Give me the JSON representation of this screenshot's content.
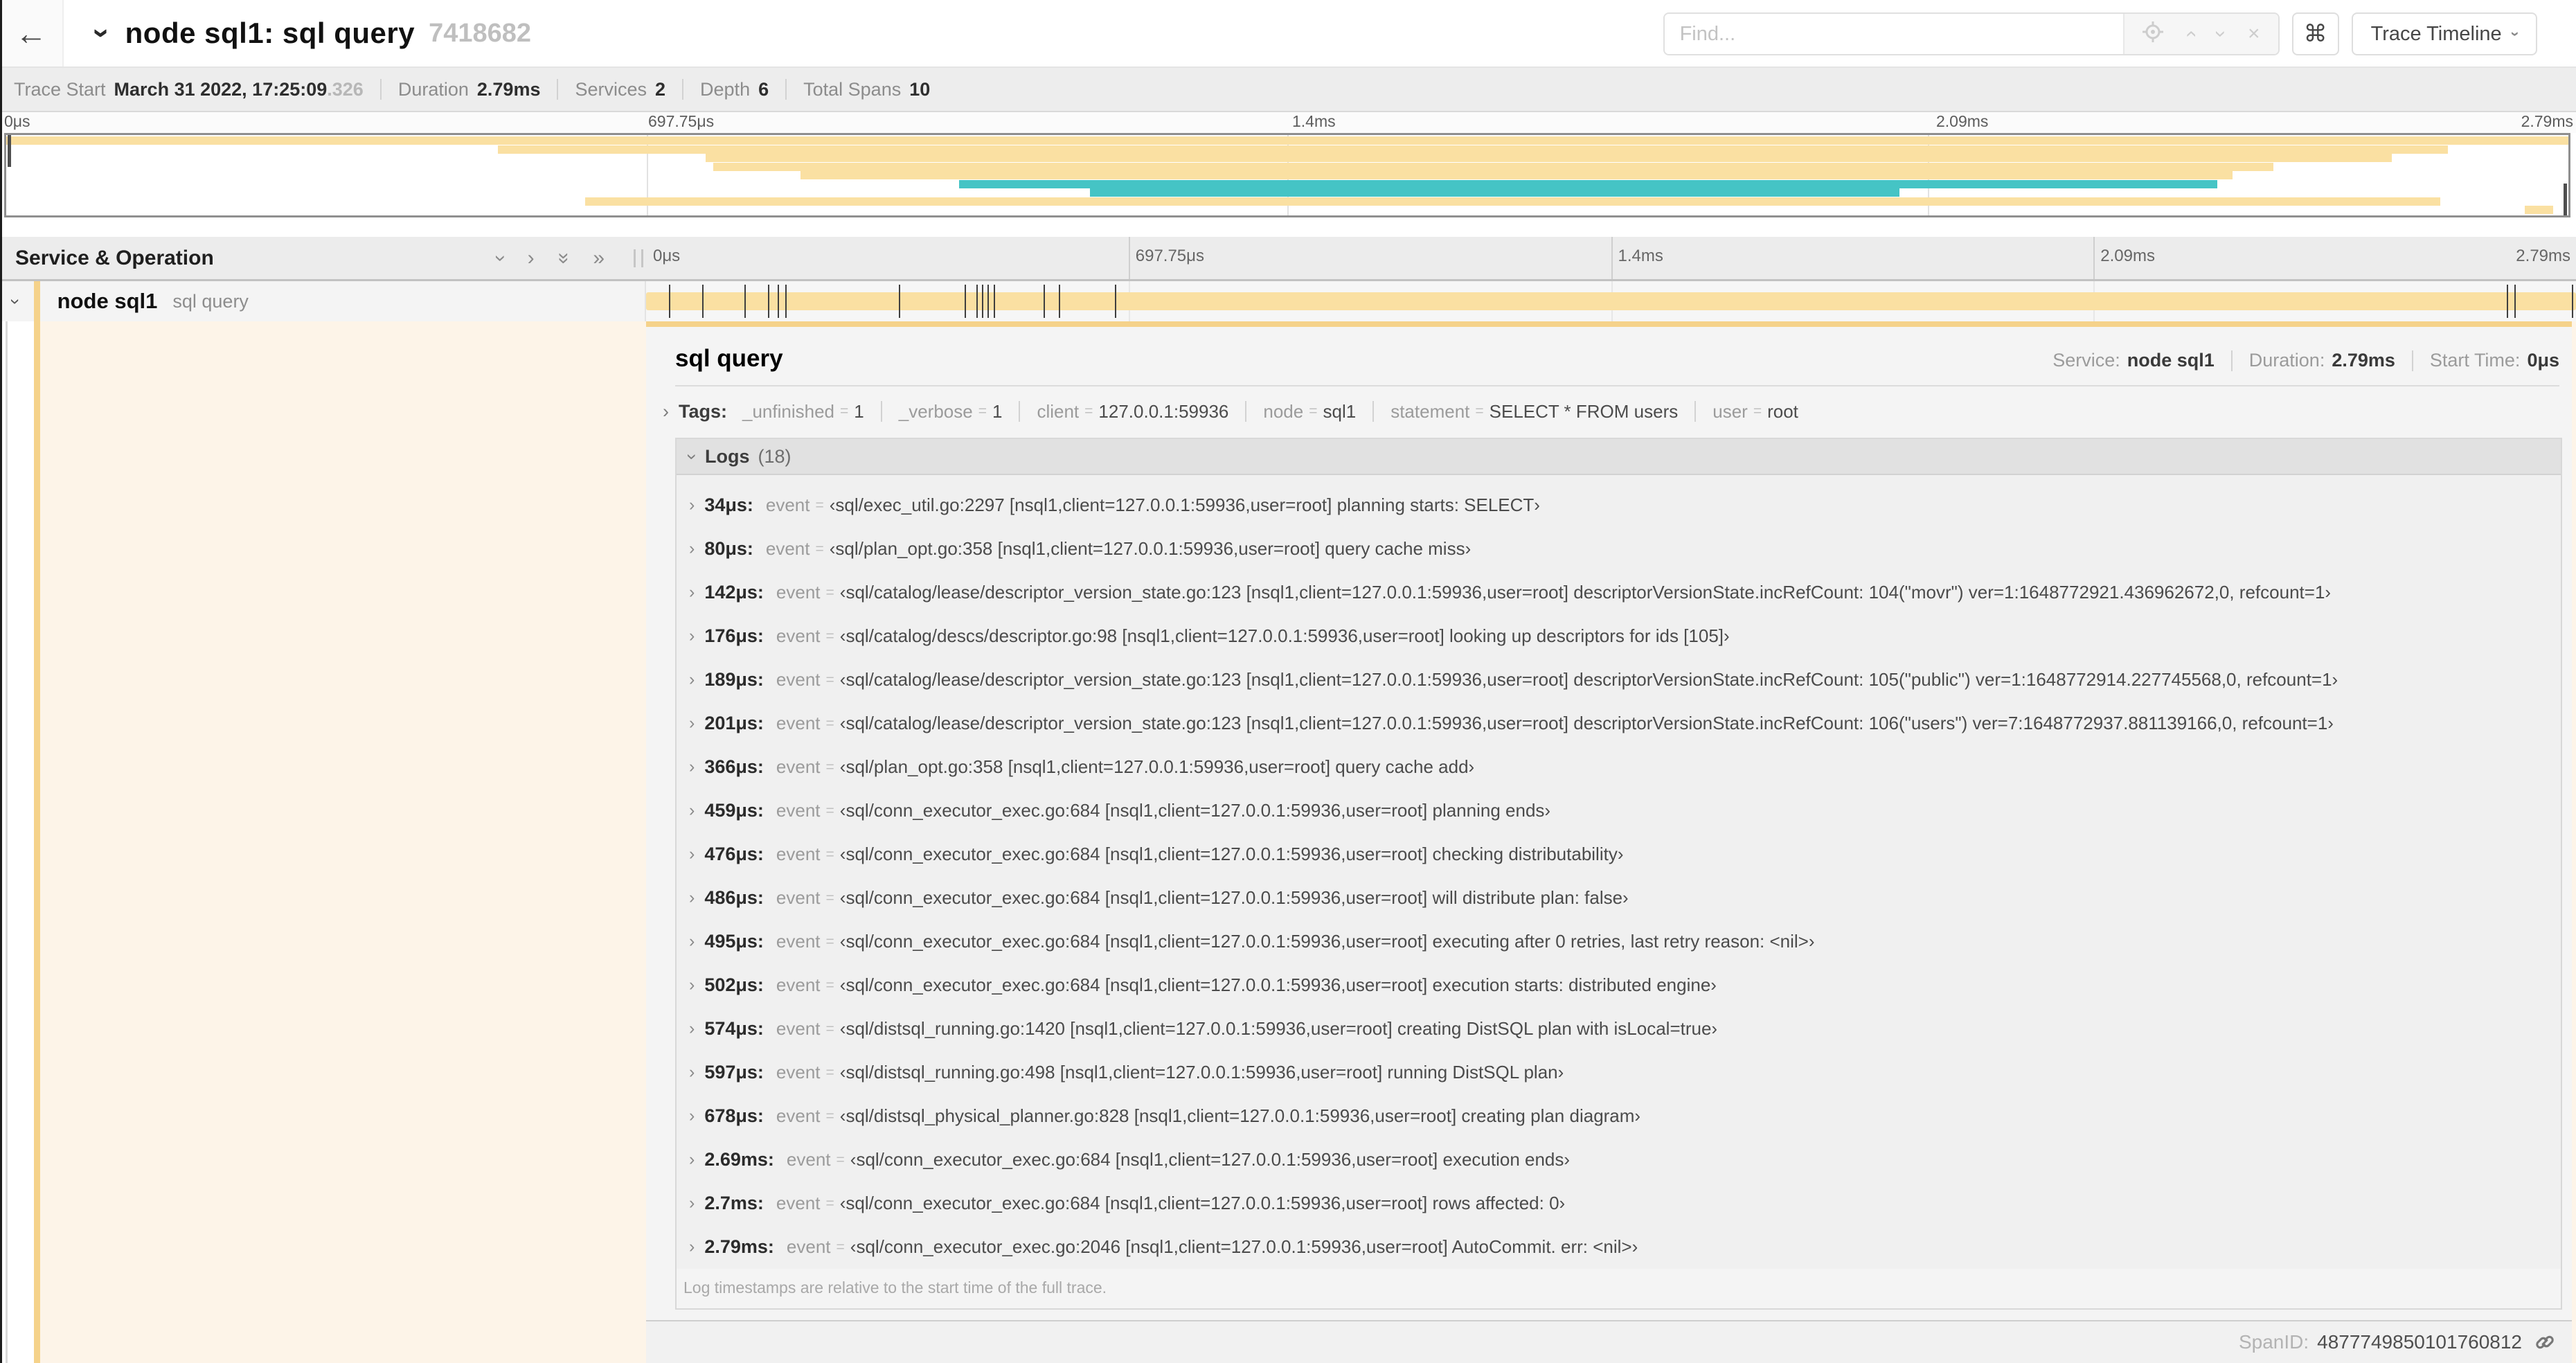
{
  "colors": {
    "orange": "#FAE0A2",
    "orange_accent": "#F5D28A",
    "teal": "#45C4C5",
    "cream": "#FDF4E8"
  },
  "header": {
    "title": "node sql1: sql query",
    "trace_id": "7418682",
    "find_placeholder": "Find...",
    "shortcut_key": "⌘",
    "view_label": "Trace Timeline"
  },
  "summary": {
    "items": [
      {
        "label": "Trace Start",
        "value": "March 31 2022, 17:25:09",
        "suffix": ".326"
      },
      {
        "label": "Duration",
        "value": "2.79ms"
      },
      {
        "label": "Services",
        "value": "2"
      },
      {
        "label": "Depth",
        "value": "6"
      },
      {
        "label": "Total Spans",
        "value": "10"
      }
    ]
  },
  "timeline": {
    "left_header": "Service & Operation",
    "ticks": [
      {
        "label": "0μs",
        "pct": 0
      },
      {
        "label": "697.75μs",
        "pct": 25
      },
      {
        "label": "1.4ms",
        "pct": 50
      },
      {
        "label": "2.09ms",
        "pct": 75
      },
      {
        "label": "2.79ms",
        "pct": 100
      }
    ],
    "grid_pcts": [
      25,
      50,
      75
    ],
    "row": {
      "service": "node sql1",
      "operation": "sql query",
      "bar_start_pct": 0,
      "bar_end_pct": 100,
      "tick_pcts": [
        1.2,
        2.9,
        5.1,
        6.3,
        6.8,
        7.2,
        13.1,
        16.5,
        17.1,
        17.4,
        17.7,
        18.0,
        20.6,
        21.4,
        24.3,
        96.4,
        96.8,
        99.8
      ]
    }
  },
  "minimap": {
    "spans": [
      {
        "color": "orange",
        "start_pct": 0,
        "end_pct": 100
      },
      {
        "color": "orange",
        "start_pct": 19.2,
        "end_pct": 95.3
      },
      {
        "color": "orange",
        "start_pct": 27.3,
        "end_pct": 93.1
      },
      {
        "color": "orange",
        "start_pct": 27.6,
        "end_pct": 88.5
      },
      {
        "color": "orange",
        "start_pct": 31.0,
        "end_pct": 86.9
      },
      {
        "color": "teal",
        "start_pct": 37.2,
        "end_pct": 86.3
      },
      {
        "color": "teal",
        "start_pct": 42.3,
        "end_pct": 73.9
      },
      {
        "color": "orange",
        "start_pct": 22.6,
        "end_pct": 95.0
      },
      {
        "color": "orange",
        "start_pct": 98.3,
        "end_pct": 99.4
      }
    ]
  },
  "detail": {
    "title": "sql query",
    "meta": [
      {
        "label": "Service:",
        "value": "node sql1"
      },
      {
        "label": "Duration:",
        "value": "2.79ms"
      },
      {
        "label": "Start Time:",
        "value": "0μs"
      }
    ],
    "tags_label": "Tags:",
    "tags": [
      {
        "key": "_unfinished",
        "value": "1"
      },
      {
        "key": "_verbose",
        "value": "1"
      },
      {
        "key": "client",
        "value": "127.0.0.1:59936"
      },
      {
        "key": "node",
        "value": "sql1"
      },
      {
        "key": "statement",
        "value": "SELECT * FROM users"
      },
      {
        "key": "user",
        "value": "root"
      }
    ],
    "logs_label": "Logs",
    "logs_count": "(18)",
    "logs": [
      {
        "time": "34μs:",
        "key": "event",
        "value": "‹sql/exec_util.go:2297 [nsql1,client=127.0.0.1:59936,user=root] planning starts: SELECT›"
      },
      {
        "time": "80μs:",
        "key": "event",
        "value": "‹sql/plan_opt.go:358 [nsql1,client=127.0.0.1:59936,user=root] query cache miss›"
      },
      {
        "time": "142μs:",
        "key": "event",
        "value": "‹sql/catalog/lease/descriptor_version_state.go:123 [nsql1,client=127.0.0.1:59936,user=root] descriptorVersionState.incRefCount: 104(\"movr\") ver=1:1648772921.436962672,0, refcount=1›"
      },
      {
        "time": "176μs:",
        "key": "event",
        "value": "‹sql/catalog/descs/descriptor.go:98 [nsql1,client=127.0.0.1:59936,user=root] looking up descriptors for ids [105]›"
      },
      {
        "time": "189μs:",
        "key": "event",
        "value": "‹sql/catalog/lease/descriptor_version_state.go:123 [nsql1,client=127.0.0.1:59936,user=root] descriptorVersionState.incRefCount: 105(\"public\") ver=1:1648772914.227745568,0, refcount=1›"
      },
      {
        "time": "201μs:",
        "key": "event",
        "value": "‹sql/catalog/lease/descriptor_version_state.go:123 [nsql1,client=127.0.0.1:59936,user=root] descriptorVersionState.incRefCount: 106(\"users\") ver=7:1648772937.881139166,0, refcount=1›"
      },
      {
        "time": "366μs:",
        "key": "event",
        "value": "‹sql/plan_opt.go:358 [nsql1,client=127.0.0.1:59936,user=root] query cache add›"
      },
      {
        "time": "459μs:",
        "key": "event",
        "value": "‹sql/conn_executor_exec.go:684 [nsql1,client=127.0.0.1:59936,user=root] planning ends›"
      },
      {
        "time": "476μs:",
        "key": "event",
        "value": "‹sql/conn_executor_exec.go:684 [nsql1,client=127.0.0.1:59936,user=root] checking distributability›"
      },
      {
        "time": "486μs:",
        "key": "event",
        "value": "‹sql/conn_executor_exec.go:684 [nsql1,client=127.0.0.1:59936,user=root] will distribute plan: false›"
      },
      {
        "time": "495μs:",
        "key": "event",
        "value": "‹sql/conn_executor_exec.go:684 [nsql1,client=127.0.0.1:59936,user=root] executing after 0 retries, last retry reason: <nil>›"
      },
      {
        "time": "502μs:",
        "key": "event",
        "value": "‹sql/conn_executor_exec.go:684 [nsql1,client=127.0.0.1:59936,user=root] execution starts: distributed engine›"
      },
      {
        "time": "574μs:",
        "key": "event",
        "value": "‹sql/distsql_running.go:1420 [nsql1,client=127.0.0.1:59936,user=root] creating DistSQL plan with isLocal=true›"
      },
      {
        "time": "597μs:",
        "key": "event",
        "value": "‹sql/distsql_running.go:498 [nsql1,client=127.0.0.1:59936,user=root] running DistSQL plan›"
      },
      {
        "time": "678μs:",
        "key": "event",
        "value": "‹sql/distsql_physical_planner.go:828 [nsql1,client=127.0.0.1:59936,user=root] creating plan diagram›"
      },
      {
        "time": "2.69ms:",
        "key": "event",
        "value": "‹sql/conn_executor_exec.go:684 [nsql1,client=127.0.0.1:59936,user=root] execution ends›"
      },
      {
        "time": "2.7ms:",
        "key": "event",
        "value": "‹sql/conn_executor_exec.go:684 [nsql1,client=127.0.0.1:59936,user=root] rows affected: 0›"
      },
      {
        "time": "2.79ms:",
        "key": "event",
        "value": "‹sql/conn_executor_exec.go:2046 [nsql1,client=127.0.0.1:59936,user=root] AutoCommit. err: <nil>›"
      }
    ],
    "logs_note": "Log timestamps are relative to the start time of the full trace.",
    "spanid_label": "SpanID:",
    "spanid": "4877749850101760812"
  }
}
